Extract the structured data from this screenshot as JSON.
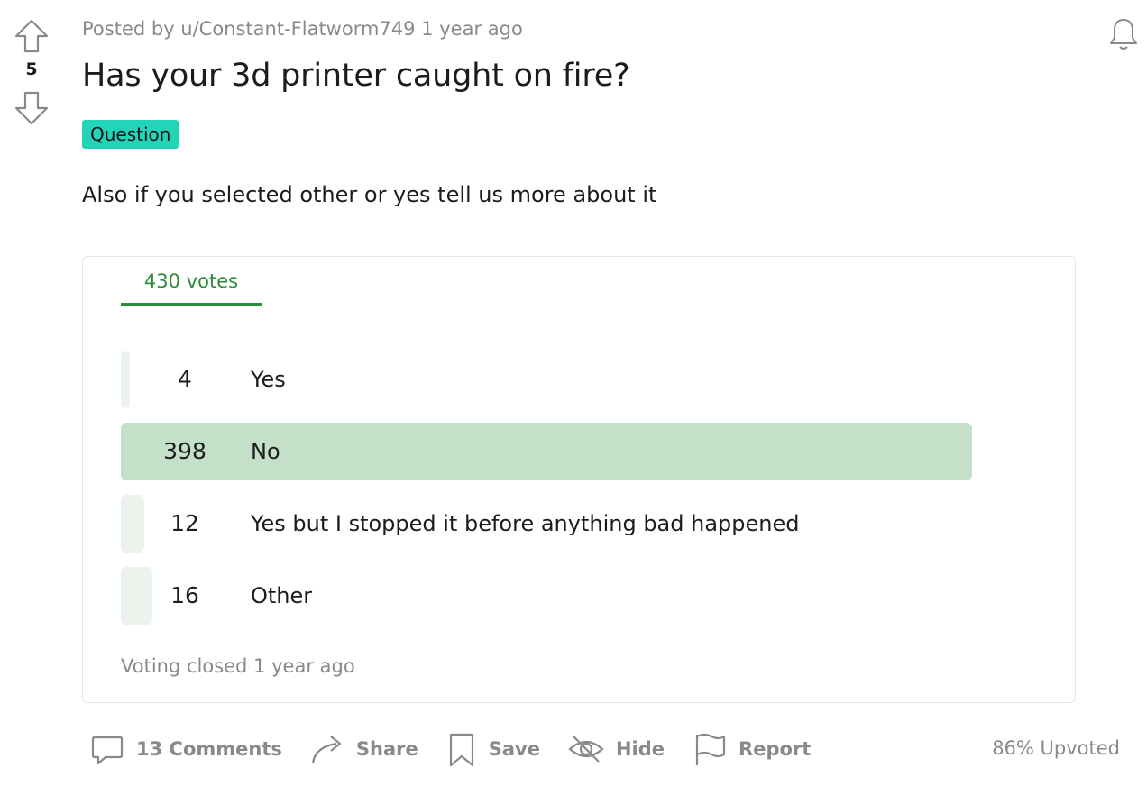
{
  "post": {
    "meta": "Posted by u/Constant-Flatworm749 1 year ago",
    "score": "5",
    "title": "Has your 3d printer caught on fire?",
    "flair": "Question",
    "body": "Also if you selected other or yes tell us more about it"
  },
  "poll": {
    "tab_label": "430 votes",
    "options": [
      {
        "count": "4",
        "label": "Yes",
        "fraction": 0.01,
        "winner": false
      },
      {
        "count": "398",
        "label": "No",
        "fraction": 0.926,
        "winner": true
      },
      {
        "count": "12",
        "label": "Yes but I stopped it before anything bad happened",
        "fraction": 0.028,
        "winner": false
      },
      {
        "count": "16",
        "label": "Other",
        "fraction": 0.037,
        "winner": false
      }
    ],
    "footer": "Voting closed 1 year ago",
    "accent": "#2e8b3a",
    "winner_color": "#c5e0c8",
    "bar_color": "#ebf3ec"
  },
  "actions": {
    "comments": "13 Comments",
    "share": "Share",
    "save": "Save",
    "hide": "Hide",
    "report": "Report",
    "upvoted": "86% Upvoted"
  },
  "colors": {
    "flair_bg": "#24d4b8",
    "muted": "#878a8c"
  }
}
